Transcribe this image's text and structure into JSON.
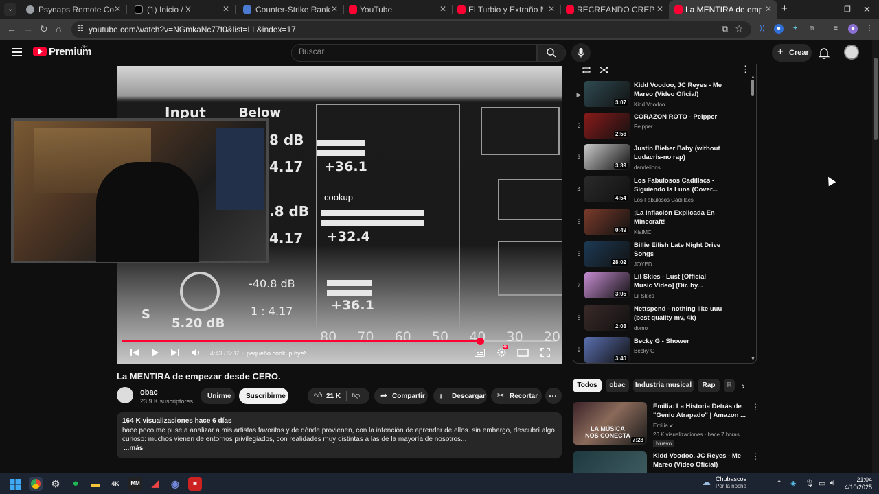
{
  "browser": {
    "tabs": [
      {
        "title": "Psynaps Remote Control",
        "favicon_color": "#9aa0a6"
      },
      {
        "title": "(1) Inicio / X",
        "favicon_color": "#000000"
      },
      {
        "title": "Counter-Strike Ranking | Valve",
        "favicon_color": "#4a7bd0"
      },
      {
        "title": "YouTube",
        "favicon_color": "#ff0033"
      },
      {
        "title": "El Turbio y Extraño Mundo de",
        "favicon_color": "#ff0033"
      },
      {
        "title": "RECREANDO CREPÚSCULO 🧛",
        "favicon_color": "#ff0033"
      },
      {
        "title": "La MENTIRA de empezar desde",
        "favicon_color": "#ff0033"
      }
    ],
    "new_tab": "+",
    "url": "youtube.com/watch?v=NGmkaNc77f0&list=LL&index=17"
  },
  "youtube": {
    "logo_text": "Premium",
    "country": "AR",
    "search_placeholder": "Buscar",
    "create_label": "Crear"
  },
  "video": {
    "overlay": {
      "input": "Input",
      "below": "Below",
      "db1": "8 dB",
      "r1": "4.17",
      "v1": "+36.1",
      "db2": ".8 dB",
      "r2": "4.17",
      "v2": "+32.4",
      "db3": "-40.8 dB",
      "r3": "1 : 4.17",
      "v3": "+36.1",
      "knob": "5.20 dB",
      "s": "S",
      "scale": [
        "80",
        "70",
        "60",
        "50",
        "40",
        "30",
        "20"
      ],
      "watermark": "cookup"
    },
    "progress": 0.825,
    "current_time": "4:43",
    "duration": "5:37",
    "time_display": "4:43 / 5:37",
    "chapter": "pequeño cookup bye",
    "settings_badge": "4K"
  },
  "details": {
    "title": "La MENTIRA de empezar desde CERO.",
    "channel": "obac",
    "subscribers": "23,9 K suscriptores",
    "join": "Unirme",
    "subscribe": "Suscribirme",
    "likes": "21 K",
    "share": "Compartir",
    "download": "Descargar",
    "clip": "Recortar",
    "stats": "164 K visualizaciones  hace 6 días",
    "description": "hace poco me puse a analizar a mis artistas favoritos y de dónde provienen, con la intención de aprender de ellos. sin embargo, descubrí algo curioso: muchos vienen de entornos privilegiados, con realidades muy distintas a las de la mayoría de nosotros...",
    "more": "...más"
  },
  "playlist": {
    "items": [
      {
        "index": "▶",
        "title": "Kidd Voodoo, JC Reyes - Me Mareo (Video Oficial)",
        "channel": "Kidd Voodoo",
        "duration": "3:07",
        "color": "#2f4b52"
      },
      {
        "index": "2",
        "title": "CORAZON ROTO - Peipper",
        "channel": "Peipper",
        "duration": "2:56",
        "color": "#8b1a1a"
      },
      {
        "index": "3",
        "title": "Justin Bieber Baby (without Ludacris-no rap)",
        "channel": "dandelions",
        "duration": "3:39",
        "color": "#c9c9c9"
      },
      {
        "index": "4",
        "title": "Los Fabulosos Cadillacs - Siguiendo la Luna (Cover...",
        "channel": "Los Fabulosos Cadillacs",
        "duration": "4:54",
        "color": "#2a2a2a"
      },
      {
        "index": "5",
        "title": "¡La Inflación Explicada En Minecraft!",
        "channel": "KialMC",
        "duration": "0:49",
        "color": "#7a3b2b"
      },
      {
        "index": "6",
        "title": "Billie Eilish Late Night Drive Songs",
        "channel": "JOYED",
        "duration": "28:02",
        "color": "#1d3a55"
      },
      {
        "index": "7",
        "title": "Lil Skies - Lust [Official Music Video] (Dir. by...",
        "channel": "Lil Skies",
        "duration": "3:05",
        "color": "#c58bd1"
      },
      {
        "index": "8",
        "title": "Nettspend - nothing like uuu (best quality mv, 4k)",
        "channel": "domo",
        "duration": "2:03",
        "color": "#3a2a28"
      },
      {
        "index": "9",
        "title": "Becky G - Shower",
        "channel": "Becky G",
        "duration": "3:40",
        "color": "#5a6fb0"
      }
    ]
  },
  "chips": [
    "Todos",
    "obac",
    "Industria musical",
    "Rap",
    "R"
  ],
  "recommendations": [
    {
      "title": "Emilia: La Historia Detrás de \"Genio Atrapado\" | Amazon ...",
      "channel": "Emilia",
      "meta": "20 K visualizaciones · hace 7 horas",
      "badge": "Nuevo",
      "duration": "7:28",
      "thumb_text": "LA MÚSICA NOS CONECTA"
    },
    {
      "title": "Kidd Voodoo, JC Reyes - Me Mareo (Video Oficial)",
      "channel": "",
      "meta": "",
      "badge": "",
      "duration": "",
      "thumb_text": ""
    }
  ],
  "taskbar": {
    "weather_title": "Chubascos",
    "weather_sub": "Por la noche",
    "time": "21:04",
    "date": "4/10/2025"
  }
}
